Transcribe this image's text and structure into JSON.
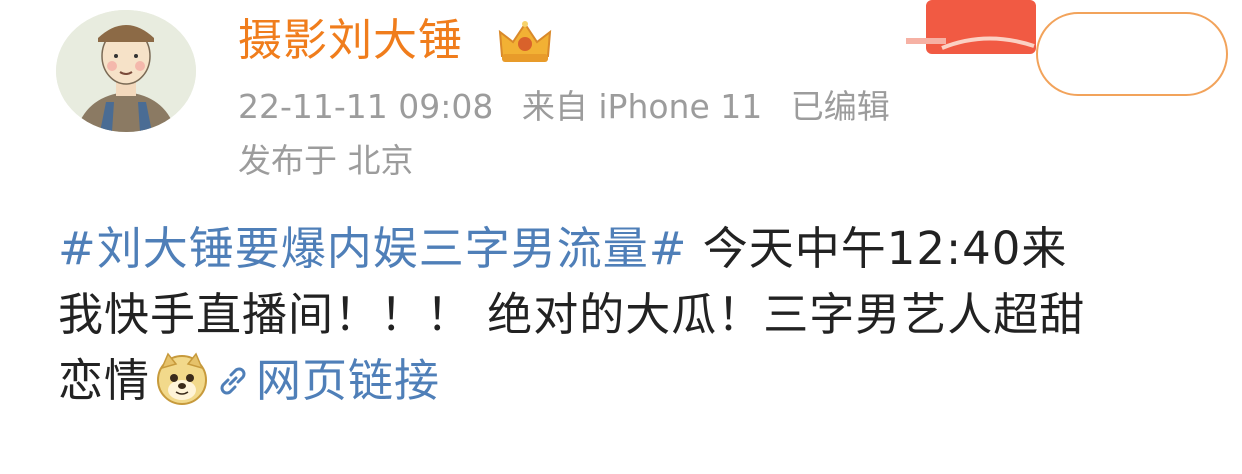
{
  "post": {
    "author": {
      "name": "摄影刘大锤"
    },
    "meta": {
      "timestamp": "22-11-11 09:08",
      "source": "来自 iPhone 11",
      "edited": "已编辑",
      "location": "发布于 北京"
    },
    "content": {
      "topic": "#刘大锤要爆内娱三字男流量#",
      "line1_text": " 今天中午12:40来",
      "line2_text": "我快手直播间！！！ 绝对的大瓜！三字男艺人超甜",
      "line3_text": "恋情",
      "emoji_icon": "doge-emoji-icon",
      "link_icon": "link-icon",
      "link_label": "网页链接"
    }
  },
  "colors": {
    "username": "#f07d1c",
    "meta": "#9c9c9c",
    "body_text": "#222222",
    "link": "#4f7fb8",
    "follow_border": "#f2a35b"
  }
}
